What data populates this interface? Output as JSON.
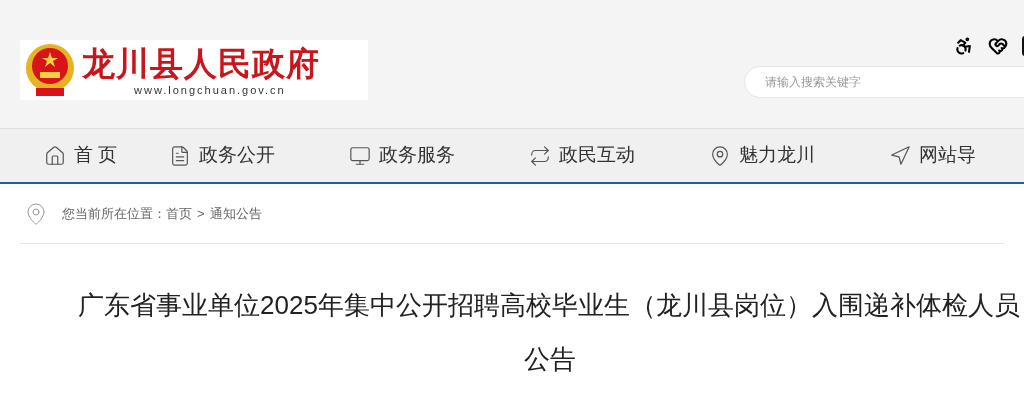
{
  "header": {
    "logo_title": "龙川县人民政府",
    "logo_url": "www.longchuan.gov.cn",
    "search": {
      "placeholder": "请输入搜索关键字"
    }
  },
  "nav": [
    {
      "label": "首 页"
    },
    {
      "label": "政务公开"
    },
    {
      "label": "政务服务"
    },
    {
      "label": "政民互动"
    },
    {
      "label": "魅力龙川"
    },
    {
      "label": "网站导"
    }
  ],
  "breadcrumb": {
    "prefix": "您当前所在位置：",
    "items": [
      "首页",
      "通知公告"
    ],
    "separator": ">"
  },
  "article": {
    "title_lines": [
      "广东省事业单位2025年集中公开招聘高校毕业生（龙川县岗位）入围递补体检人员",
      "公告"
    ]
  }
}
